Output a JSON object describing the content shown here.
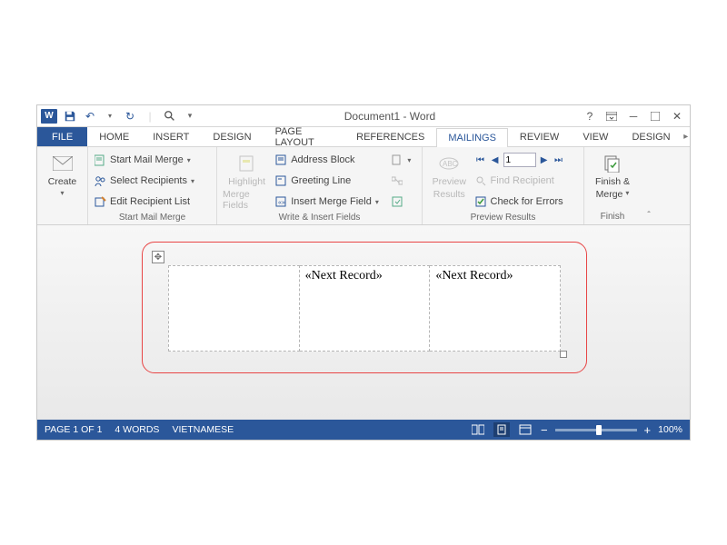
{
  "title": "Document1 - Word",
  "qat": {
    "app": "W"
  },
  "tabs": {
    "file": "FILE",
    "home": "HOME",
    "insert": "INSERT",
    "design": "DESIGN",
    "page_layout": "PAGE LAYOUT",
    "references": "REFERENCES",
    "mailings": "MAILINGS",
    "review": "REVIEW",
    "view": "VIEW",
    "design2": "DESIGN"
  },
  "ribbon": {
    "create": {
      "label": "Create"
    },
    "start_mail_merge": {
      "group_label": "Start Mail Merge",
      "start": "Start Mail Merge",
      "select": "Select Recipients",
      "edit": "Edit Recipient List"
    },
    "write_insert": {
      "group_label": "Write & Insert Fields",
      "highlight_line1": "Highlight",
      "highlight_line2": "Merge Fields",
      "address_block": "Address Block",
      "greeting_line": "Greeting Line",
      "insert_merge_field": "Insert Merge Field"
    },
    "preview": {
      "group_label": "Preview Results",
      "preview_line1": "Preview",
      "preview_line2": "Results",
      "record": "1",
      "find": "Find Recipient",
      "check": "Check for Errors"
    },
    "finish": {
      "group_label": "Finish",
      "finish_line1": "Finish &",
      "finish_line2": "Merge"
    }
  },
  "document": {
    "cell1": "",
    "cell2": "«Next Record»",
    "cell3": "«Next Record»"
  },
  "status": {
    "page": "PAGE 1 OF 1",
    "words": "4 WORDS",
    "language": "VIETNAMESE",
    "zoom": "100%"
  }
}
